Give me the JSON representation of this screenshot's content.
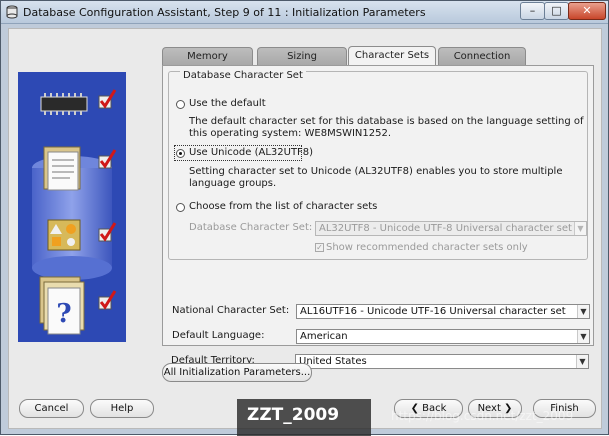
{
  "window": {
    "title": "Database Configuration Assistant, Step 9 of 11 : Initialization Parameters",
    "controls": {
      "minimize": "–",
      "maximize": "□",
      "close": "✕"
    }
  },
  "tabs": [
    {
      "label": "Memory",
      "active": false
    },
    {
      "label": "Sizing",
      "active": false
    },
    {
      "label": "Character Sets",
      "active": true
    },
    {
      "label": "Connection Mode",
      "active": false
    }
  ],
  "charset_group": {
    "title": "Database Character Set",
    "options": [
      {
        "label": "Use the default",
        "selected": false,
        "description": "The default character set for this database is based on the language setting of this operating system: WE8MSWIN1252."
      },
      {
        "label": "Use Unicode (AL32UTF8)",
        "selected": true,
        "description": "Setting character set to Unicode (AL32UTF8) enables you to store multiple language groups."
      },
      {
        "label": "Choose from the list of character sets",
        "selected": false
      }
    ],
    "db_charset_label": "Database Character Set:",
    "db_charset_value": "AL32UTF8 - Unicode UTF-8 Universal character set",
    "show_recommended_label": "Show recommended character sets only",
    "show_recommended_checked": true
  },
  "national_charset": {
    "label": "National Character Set:",
    "value": "AL16UTF16 - Unicode UTF-16 Universal character set"
  },
  "default_language": {
    "label": "Default Language:",
    "value": "American"
  },
  "default_territory": {
    "label": "Default Territory:",
    "value": "United States"
  },
  "buttons": {
    "all_params": "All Initialization Parameters...",
    "cancel": "Cancel",
    "help": "Help",
    "back": "Back",
    "next": "Next",
    "finish": "Finish"
  },
  "watermark": {
    "text": "ZZT_2009",
    "url": "https://blog.csdn.net/zzt_2009"
  },
  "colors": {
    "side_panel": "#2d49b4",
    "check_red": "#d01818",
    "window_frame": "#bfcbda"
  }
}
